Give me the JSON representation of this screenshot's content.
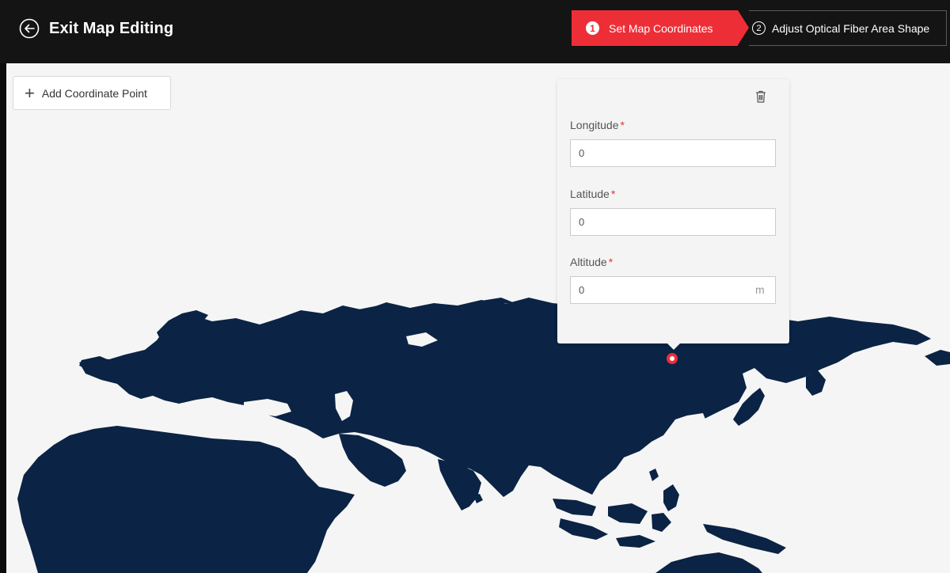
{
  "header": {
    "exit_label": "Exit Map Editing",
    "steps": [
      {
        "number": "1",
        "label": "Set Map Coordinates",
        "state": "active"
      },
      {
        "number": "2",
        "label": "Adjust Optical Fiber Area Shape",
        "state": "inactive"
      }
    ]
  },
  "toolbar": {
    "add_point_label": "Add Coordinate Point"
  },
  "coordinate_popup": {
    "longitude": {
      "label": "Longitude",
      "required_mark": "*",
      "value": "0"
    },
    "latitude": {
      "label": "Latitude",
      "required_mark": "*",
      "value": "0"
    },
    "altitude": {
      "label": "Altitude",
      "required_mark": "*",
      "value": "0",
      "unit": "m"
    }
  },
  "icons": [
    "back-circle-icon",
    "plus-icon",
    "trash-icon",
    "map-pin-icon"
  ],
  "colors": {
    "accent": "#ee2e36",
    "header_bg": "#141414",
    "map_land": "#0b2344",
    "map_bg": "#f5f5f5"
  }
}
